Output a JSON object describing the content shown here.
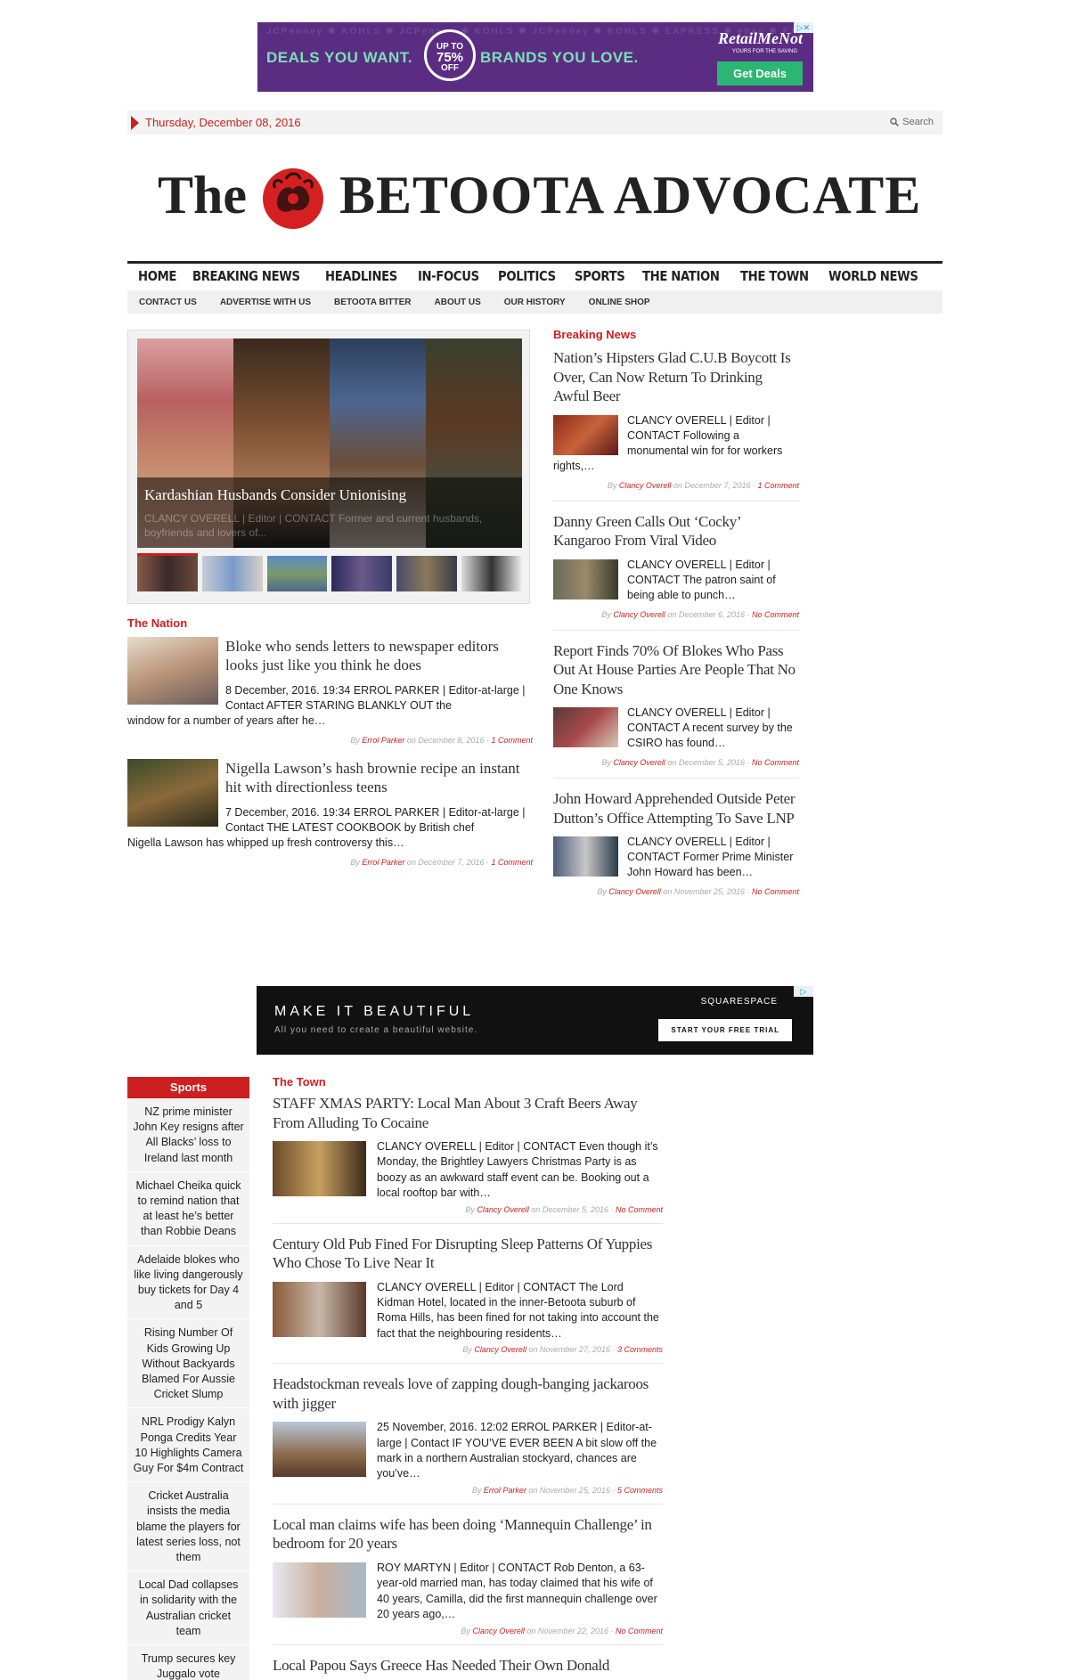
{
  "top_ad": {
    "pattern_text": "JCPenney ✱ KOHLS ✱ JCPenney ✱ KOHLS ✱ JCPenney ✱ KOHLS ✱ EXPRESS ✱ ebay ✱ EXPRESS",
    "deals": "DEALS YOU WANT.",
    "badge_top": "UP TO",
    "badge_pct": "75%",
    "badge_off": "OFF",
    "brands": "BRANDS YOU LOVE.",
    "brand": "RetailMeNot",
    "brand_sub": "YOURS FOR THE SAVING",
    "cta": "Get Deals",
    "adchoice": "▷✕"
  },
  "datebar": {
    "date": "Thursday, December 08, 2016",
    "search": "Search"
  },
  "masthead": {
    "the": "The",
    "name": "BETOOTA ADVOCATE"
  },
  "nav": {
    "main": [
      "HOME",
      "BREAKING NEWS",
      "HEADLINES",
      "IN-FOCUS",
      "POLITICS",
      "SPORTS",
      "THE NATION",
      "THE TOWN",
      "WORLD NEWS"
    ],
    "sub": [
      "CONTACT US",
      "ADVERTISE WITH US",
      "BETOOTA BITTER",
      "ABOUT US",
      "OUR HISTORY",
      "ONLINE SHOP"
    ]
  },
  "slider": {
    "title": "Kardashian Husbands Consider Unionising",
    "excerpt": "CLANCY OVERELL | Editor | CONTACT Former and current husbands, boyfriends and lovers of..."
  },
  "nation": {
    "heading": "The Nation",
    "items": [
      {
        "headline": "Bloke who sends letters to newspaper editors looks just like you think he does",
        "excerpt_a": "8 December, 2016. 19:34 ERROL PARKER | Editor-at-large | Contact AFTER STARING BLANKLY OUT the",
        "excerpt_b": "window for a number of years after he…",
        "by": "By",
        "author": "Errol Parker",
        "on": "on December 8, 2016",
        "comments": "1 Comment"
      },
      {
        "headline": "Nigella Lawson’s hash brownie recipe an instant hit with directionless teens",
        "excerpt_a": "7 December, 2016. 19:34 ERROL PARKER | Editor-at-large | Contact THE LATEST COOKBOOK by British chef",
        "excerpt_b": "Nigella Lawson has whipped up fresh controversy this…",
        "by": "By",
        "author": "Errol Parker",
        "on": "on December 7, 2016",
        "comments": "1 Comment"
      }
    ]
  },
  "breaking": {
    "heading": "Breaking News",
    "items": [
      {
        "headline": "Nation’s Hipsters Glad C.U.B Boycott Is Over, Can Now Return To Drinking Awful Beer",
        "excerpt": "CLANCY OVERELL | Editor | CONTACT Following a monumental win for for workers rights,…",
        "by": "By",
        "author": "Clancy Overell",
        "on": "on December 7, 2016",
        "comments": "1 Comment"
      },
      {
        "headline": "Danny Green Calls Out ‘Cocky’ Kangaroo From Viral Video",
        "excerpt": "CLANCY OVERELL | Editor | CONTACT The patron saint of being able to punch…",
        "by": "By",
        "author": "Clancy Overell",
        "on": "on December 6, 2016",
        "comments": "No Comment"
      },
      {
        "headline": "Report Finds 70% Of Blokes Who Pass Out At House Parties Are People That No One Knows",
        "excerpt": "CLANCY OVERELL | Editor | CONTACT A recent survey by the CSIRO has found…",
        "by": "By",
        "author": "Clancy Overell",
        "on": "on December 5, 2016",
        "comments": "No Comment"
      },
      {
        "headline": "John Howard Apprehended Outside Peter Dutton’s Office Attempting To Save LNP",
        "excerpt": "CLANCY OVERELL | Editor | CONTACT Former Prime Minister John Howard has been…",
        "by": "By",
        "author": "Clancy Overell",
        "on": "on November 25, 2016",
        "comments": "No Comment"
      }
    ]
  },
  "mid_ad": {
    "title": "MAKE IT BEAUTIFUL",
    "subtitle": "All you need to create a beautiful website.",
    "brand": "SQUARESPACE",
    "cta": "START YOUR FREE TRIAL",
    "adchoice": "▷"
  },
  "sports": {
    "heading": "Sports",
    "items": [
      "NZ prime minister John Key resigns after All Blacks’ loss to Ireland last month",
      "Michael Cheika quick to remind nation that at least he’s better than Robbie Deans",
      "Adelaide blokes who like living dangerously buy tickets for Day 4 and 5",
      "Rising Number Of Kids Growing Up Without Backyards Blamed For Aussie Cricket Slump",
      "NRL Prodigy Kalyn Ponga Credits Year 10 Highlights Camera Guy For $4m Contract",
      "Cricket Australia insists the media blame the players for latest series loss, not them",
      "Local Dad collapses in solidarity with the Australian cricket team",
      "Trump secures key Juggalo vote"
    ]
  },
  "town": {
    "heading": "The Town",
    "items": [
      {
        "headline": "STAFF XMAS PARTY: Local Man About 3 Craft Beers Away From Alluding To Cocaine",
        "excerpt": "CLANCY OVERELL | Editor | CONTACT Even though it’s Monday, the Brightley Lawyers Christmas Party is as boozy as an awkward staff event can be. Booking out a local rooftop bar with…",
        "by": "By",
        "author": "Clancy Overell",
        "on": "on December 5, 2016",
        "comments": "No Comment"
      },
      {
        "headline": "Century Old Pub Fined For Disrupting Sleep Patterns Of Yuppies Who Chose To Live Near It",
        "excerpt": "CLANCY OVERELL | Editor | CONTACT The Lord Kidman Hotel, located in the inner-Betoota suburb of Roma Hills, has been fined for not taking into account the fact that the neighbouring residents…",
        "by": "By",
        "author": "Clancy Overell",
        "on": "on November 27, 2016",
        "comments": "3 Comments"
      },
      {
        "headline": "Headstockman reveals love of zapping dough-banging jackaroos with jigger",
        "excerpt": "25 November, 2016. 12:02 ERROL PARKER | Editor-at-large | Contact IF YOU’VE EVER BEEN A bit slow off the mark in a northern Australian stockyard, chances are you’ve…",
        "by": "By",
        "author": "Errol Parker",
        "on": "on November 25, 2016",
        "comments": "5 Comments"
      },
      {
        "headline": "Local man claims wife has been doing ‘Mannequin Challenge’ in bedroom for 20 years",
        "excerpt": "ROY MARTYN | Editor | CONTACT Rob Denton, a 63-year-old married man, has today claimed that his wife of 40 years, Camilla, did the first mannequin challenge over 20 years ago,…",
        "by": "By",
        "author": "Clancy Overell",
        "on": "on November 22, 2016",
        "comments": "No Comment"
      },
      {
        "headline": "Local Papou Says Greece Has Needed Their Own Donald",
        "excerpt": "",
        "by": "",
        "author": "",
        "on": "",
        "comments": ""
      }
    ]
  },
  "colors": {
    "accent": "#cc1f1f",
    "ad_purple": "#5a2d82",
    "ad_green": "#2bb673"
  }
}
